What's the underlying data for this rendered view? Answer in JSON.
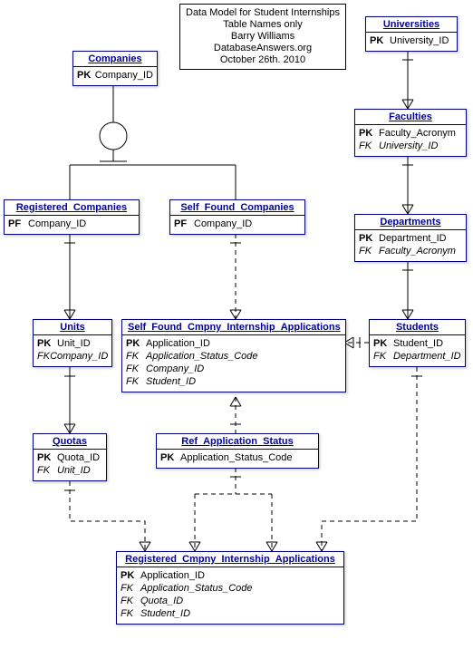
{
  "meta": {
    "line1": "Data Model for Student Internships",
    "line2": "Table Names only",
    "line3": "Barry Williams",
    "line4": "DatabaseAnswers.org",
    "line5": "October 26th. 2010"
  },
  "entities": {
    "companies": {
      "name": "Companies",
      "rows": [
        {
          "k": "PK",
          "v": "Company_ID"
        }
      ]
    },
    "universities": {
      "name": "Universities",
      "rows": [
        {
          "k": "PK",
          "v": "University_ID"
        }
      ]
    },
    "faculties": {
      "name": "Faculties",
      "rows": [
        {
          "k": "PK",
          "v": "Faculty_Acronym"
        },
        {
          "k": "FK",
          "v": "University_ID",
          "fk": true
        }
      ]
    },
    "departments": {
      "name": "Departments",
      "rows": [
        {
          "k": "PK",
          "v": "Department_ID"
        },
        {
          "k": "FK",
          "v": "Faculty_Acronym",
          "fk": true
        }
      ]
    },
    "registered_companies": {
      "name": "Registered_Companies",
      "rows": [
        {
          "k": "PF",
          "v": "Company_ID"
        }
      ]
    },
    "self_found_companies": {
      "name": "Self_Found_Companies",
      "rows": [
        {
          "k": "PF",
          "v": "Company_ID"
        }
      ]
    },
    "units": {
      "name": "Units",
      "rows": [
        {
          "k": "PK",
          "v": "Unit_ID"
        },
        {
          "k": "FK",
          "v": "Company_ID",
          "fk": true
        }
      ]
    },
    "students": {
      "name": "Students",
      "rows": [
        {
          "k": "PK",
          "v": "Student_ID"
        },
        {
          "k": "FK",
          "v": "Department_ID",
          "fk": true
        }
      ]
    },
    "sf_apps": {
      "name": "Self_Found_Cmpny_Internship_Applications",
      "rows": [
        {
          "k": "PK",
          "v": "Application_ID"
        },
        {
          "k": "FK",
          "v": "Application_Status_Code",
          "fk": true
        },
        {
          "k": "FK",
          "v": "Company_ID",
          "fk": true
        },
        {
          "k": "FK",
          "v": "Student_ID",
          "fk": true
        }
      ]
    },
    "quotas": {
      "name": "Quotas",
      "rows": [
        {
          "k": "PK",
          "v": "Quota_ID"
        },
        {
          "k": "FK",
          "v": "Unit_ID",
          "fk": true
        }
      ]
    },
    "ref_app_status": {
      "name": "Ref_Application_Status",
      "rows": [
        {
          "k": "PK",
          "v": "Application_Status_Code"
        }
      ]
    },
    "reg_apps": {
      "name": "Registered_Cmpny_Internship_Applications",
      "rows": [
        {
          "k": "PK",
          "v": "Application_ID"
        },
        {
          "k": "FK",
          "v": "Application_Status_Code",
          "fk": true
        },
        {
          "k": "FK",
          "v": "Quota_ID",
          "fk": true
        },
        {
          "k": "FK",
          "v": "Student_ID",
          "fk": true
        }
      ]
    }
  },
  "chart_data": {
    "type": "table",
    "description": "Entity-Relationship diagram: entities with keys and relationships",
    "entities": [
      {
        "name": "Companies",
        "keys": [
          [
            "PK",
            "Company_ID"
          ]
        ]
      },
      {
        "name": "Universities",
        "keys": [
          [
            "PK",
            "University_ID"
          ]
        ]
      },
      {
        "name": "Faculties",
        "keys": [
          [
            "PK",
            "Faculty_Acronym"
          ],
          [
            "FK",
            "University_ID"
          ]
        ]
      },
      {
        "name": "Departments",
        "keys": [
          [
            "PK",
            "Department_ID"
          ],
          [
            "FK",
            "Faculty_Acronym"
          ]
        ]
      },
      {
        "name": "Registered_Companies",
        "keys": [
          [
            "PF",
            "Company_ID"
          ]
        ]
      },
      {
        "name": "Self_Found_Companies",
        "keys": [
          [
            "PF",
            "Company_ID"
          ]
        ]
      },
      {
        "name": "Units",
        "keys": [
          [
            "PK",
            "Unit_ID"
          ],
          [
            "FK",
            "Company_ID"
          ]
        ]
      },
      {
        "name": "Students",
        "keys": [
          [
            "PK",
            "Student_ID"
          ],
          [
            "FK",
            "Department_ID"
          ]
        ]
      },
      {
        "name": "Self_Found_Cmpny_Internship_Applications",
        "keys": [
          [
            "PK",
            "Application_ID"
          ],
          [
            "FK",
            "Application_Status_Code"
          ],
          [
            "FK",
            "Company_ID"
          ],
          [
            "FK",
            "Student_ID"
          ]
        ]
      },
      {
        "name": "Quotas",
        "keys": [
          [
            "PK",
            "Quota_ID"
          ],
          [
            "FK",
            "Unit_ID"
          ]
        ]
      },
      {
        "name": "Ref_Application_Status",
        "keys": [
          [
            "PK",
            "Application_Status_Code"
          ]
        ]
      },
      {
        "name": "Registered_Cmpny_Internship_Applications",
        "keys": [
          [
            "PK",
            "Application_ID"
          ],
          [
            "FK",
            "Application_Status_Code"
          ],
          [
            "FK",
            "Quota_ID"
          ],
          [
            "FK",
            "Student_ID"
          ]
        ]
      }
    ],
    "relationships": [
      {
        "from": "Companies",
        "to": "Registered_Companies",
        "type": "subtype"
      },
      {
        "from": "Companies",
        "to": "Self_Found_Companies",
        "type": "subtype"
      },
      {
        "from": "Registered_Companies",
        "to": "Units",
        "type": "one-to-many-identifying"
      },
      {
        "from": "Units",
        "to": "Quotas",
        "type": "one-to-many-identifying"
      },
      {
        "from": "Self_Found_Companies",
        "to": "Self_Found_Cmpny_Internship_Applications",
        "type": "one-to-many-nonidentifying"
      },
      {
        "from": "Ref_Application_Status",
        "to": "Self_Found_Cmpny_Internship_Applications",
        "type": "one-to-many-nonidentifying"
      },
      {
        "from": "Ref_Application_Status",
        "to": "Registered_Cmpny_Internship_Applications",
        "type": "one-to-many-nonidentifying"
      },
      {
        "from": "Students",
        "to": "Self_Found_Cmpny_Internship_Applications",
        "type": "one-to-many-nonidentifying"
      },
      {
        "from": "Students",
        "to": "Registered_Cmpny_Internship_Applications",
        "type": "one-to-many-nonidentifying"
      },
      {
        "from": "Quotas",
        "to": "Registered_Cmpny_Internship_Applications",
        "type": "one-to-many-nonidentifying"
      },
      {
        "from": "Universities",
        "to": "Faculties",
        "type": "one-to-many-identifying"
      },
      {
        "from": "Faculties",
        "to": "Departments",
        "type": "one-to-many-identifying"
      },
      {
        "from": "Departments",
        "to": "Students",
        "type": "one-to-many-identifying"
      }
    ]
  }
}
